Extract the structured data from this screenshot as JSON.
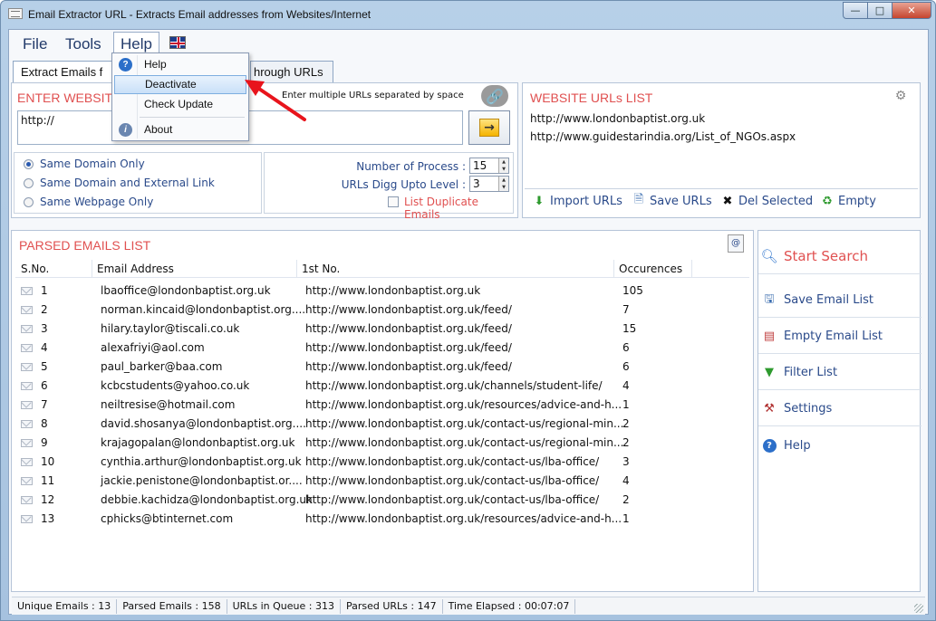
{
  "window": {
    "title": "Email Extractor URL - Extracts Email addresses from Websites/Internet",
    "buttons": {
      "minimize": "—",
      "maximize": "□",
      "close": "✕"
    }
  },
  "menubar": {
    "items": [
      "File",
      "Tools",
      "Help"
    ],
    "language_flag": "uk-flag-icon"
  },
  "help_menu": {
    "items": [
      {
        "label": "Help",
        "icon": "help-icon"
      },
      {
        "label": "Deactivate",
        "icon": ""
      },
      {
        "label": "Check Update",
        "icon": ""
      },
      {
        "label": "About",
        "icon": "about-icon"
      }
    ],
    "highlighted": "Deactivate"
  },
  "tabs": {
    "tab1_visible": "Extract Emails f",
    "tab2_visible": "hrough URLs"
  },
  "enter_panel": {
    "title_visible": "ENTER WEBSIT",
    "hint": "Enter multiple URLs separated by space",
    "url_value": "http://"
  },
  "options": {
    "radios": [
      "Same Domain Only",
      "Same Domain and External Link",
      "Same Webpage Only"
    ],
    "selected_index": 0,
    "process_label": "Number of Process :",
    "process_value": "15",
    "digg_label": "URLs Digg Upto Level :",
    "digg_value": "3",
    "duplicate_label": "List Duplicate Emails"
  },
  "url_list": {
    "title": "WEBSITE URLs LIST",
    "items": [
      "http://www.londonbaptist.org.uk",
      "http://www.guidestarindia.org/List_of_NGOs.aspx"
    ],
    "toolbar": {
      "import": "Import URLs",
      "save": "Save URLs",
      "delete": "Del Selected",
      "empty": "Empty"
    }
  },
  "emails": {
    "title": "PARSED EMAILS LIST",
    "columns": [
      "S.No.",
      "Email Address",
      "1st No.",
      "Occurences"
    ],
    "rows": [
      [
        "1",
        "lbaoffice@londonbaptist.org.uk",
        "http://www.londonbaptist.org.uk",
        "105"
      ],
      [
        "2",
        "norman.kincaid@londonbaptist.org....",
        "http://www.londonbaptist.org.uk/feed/",
        "7"
      ],
      [
        "3",
        "hilary.taylor@tiscali.co.uk",
        "http://www.londonbaptist.org.uk/feed/",
        "15"
      ],
      [
        "4",
        "alexafriyi@aol.com",
        "http://www.londonbaptist.org.uk/feed/",
        "6"
      ],
      [
        "5",
        "paul_barker@baa.com",
        "http://www.londonbaptist.org.uk/feed/",
        "6"
      ],
      [
        "6",
        "kcbcstudents@yahoo.co.uk",
        "http://www.londonbaptist.org.uk/channels/student-life/",
        "4"
      ],
      [
        "7",
        "neiltresise@hotmail.com",
        "http://www.londonbaptist.org.uk/resources/advice-and-h...",
        "1"
      ],
      [
        "8",
        "david.shosanya@londonbaptist.org....",
        "http://www.londonbaptist.org.uk/contact-us/regional-min...",
        "2"
      ],
      [
        "9",
        "krajagopalan@londonbaptist.org.uk",
        "http://www.londonbaptist.org.uk/contact-us/regional-min...",
        "2"
      ],
      [
        "10",
        "cynthia.arthur@londonbaptist.org.uk",
        "http://www.londonbaptist.org.uk/contact-us/lba-office/",
        "3"
      ],
      [
        "11",
        "jackie.penistone@londonbaptist.or....",
        "http://www.londonbaptist.org.uk/contact-us/lba-office/",
        "4"
      ],
      [
        "12",
        "debbie.kachidza@londonbaptist.org.uk",
        "http://www.londonbaptist.org.uk/contact-us/lba-office/",
        "2"
      ],
      [
        "13",
        "cphicks@btinternet.com",
        "http://www.londonbaptist.org.uk/resources/advice-and-h...",
        "1"
      ]
    ]
  },
  "sidebar": {
    "start": "Start Search",
    "items": [
      "Save Email List",
      "Empty Email List",
      "Filter List",
      "Settings",
      "Help"
    ]
  },
  "status": {
    "cells": [
      "Unique Emails :  13",
      "Parsed Emails :  158",
      "URLs in Queue :  313",
      "Parsed URLs :  147",
      "Time Elapsed :  00:07:07"
    ]
  },
  "colors": {
    "accent_red": "#e05050",
    "link_blue": "#2a4a8a",
    "annotation_arrow": "#e8141c"
  }
}
